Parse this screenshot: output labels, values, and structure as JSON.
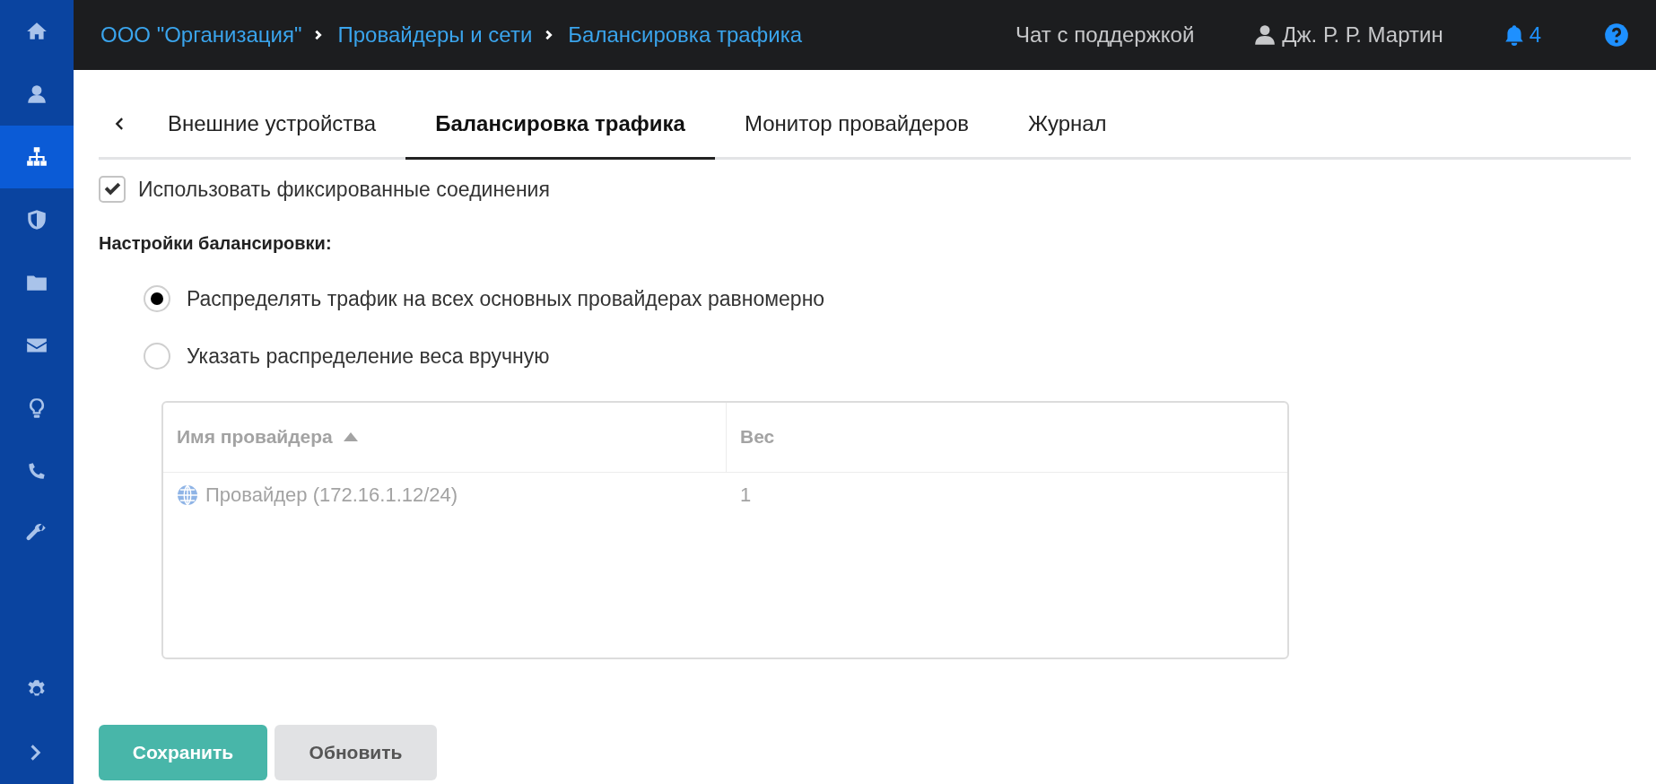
{
  "sidebar": {
    "items": [
      {
        "selected": false
      },
      {
        "selected": false
      },
      {
        "selected": true
      },
      {
        "selected": false
      },
      {
        "selected": false
      },
      {
        "selected": false
      },
      {
        "selected": false
      },
      {
        "selected": false
      },
      {
        "selected": false
      }
    ]
  },
  "header": {
    "breadcrumbs": [
      "ООО \"Организация\"",
      "Провайдеры и сети",
      "Балансировка трафика"
    ],
    "support_link": "Чат с поддержкой",
    "user": "Дж. Р. Р. Мартин",
    "notifications": "4"
  },
  "tabs": [
    {
      "label": "Внешние устройства",
      "selected": false
    },
    {
      "label": "Балансировка трафика",
      "selected": true
    },
    {
      "label": "Монитор провайдеров",
      "selected": false
    },
    {
      "label": "Журнал",
      "selected": false
    }
  ],
  "sticky_checkbox": {
    "label": "Использовать фиксированные соединения",
    "checked": true
  },
  "section_title": "Настройки балансировки:",
  "radios": [
    {
      "label": "Распределять трафик на всех основных провайдерах равномерно",
      "selected": true
    },
    {
      "label": "Указать распределение веса вручную",
      "selected": false
    }
  ],
  "table": {
    "disabled": true,
    "columns": [
      "Имя провайдера",
      "Вес"
    ],
    "rows": [
      [
        "Провайдер (172.16.1.12/24)",
        "1"
      ]
    ]
  },
  "buttons": [
    "Сохранить",
    "Обновить"
  ]
}
